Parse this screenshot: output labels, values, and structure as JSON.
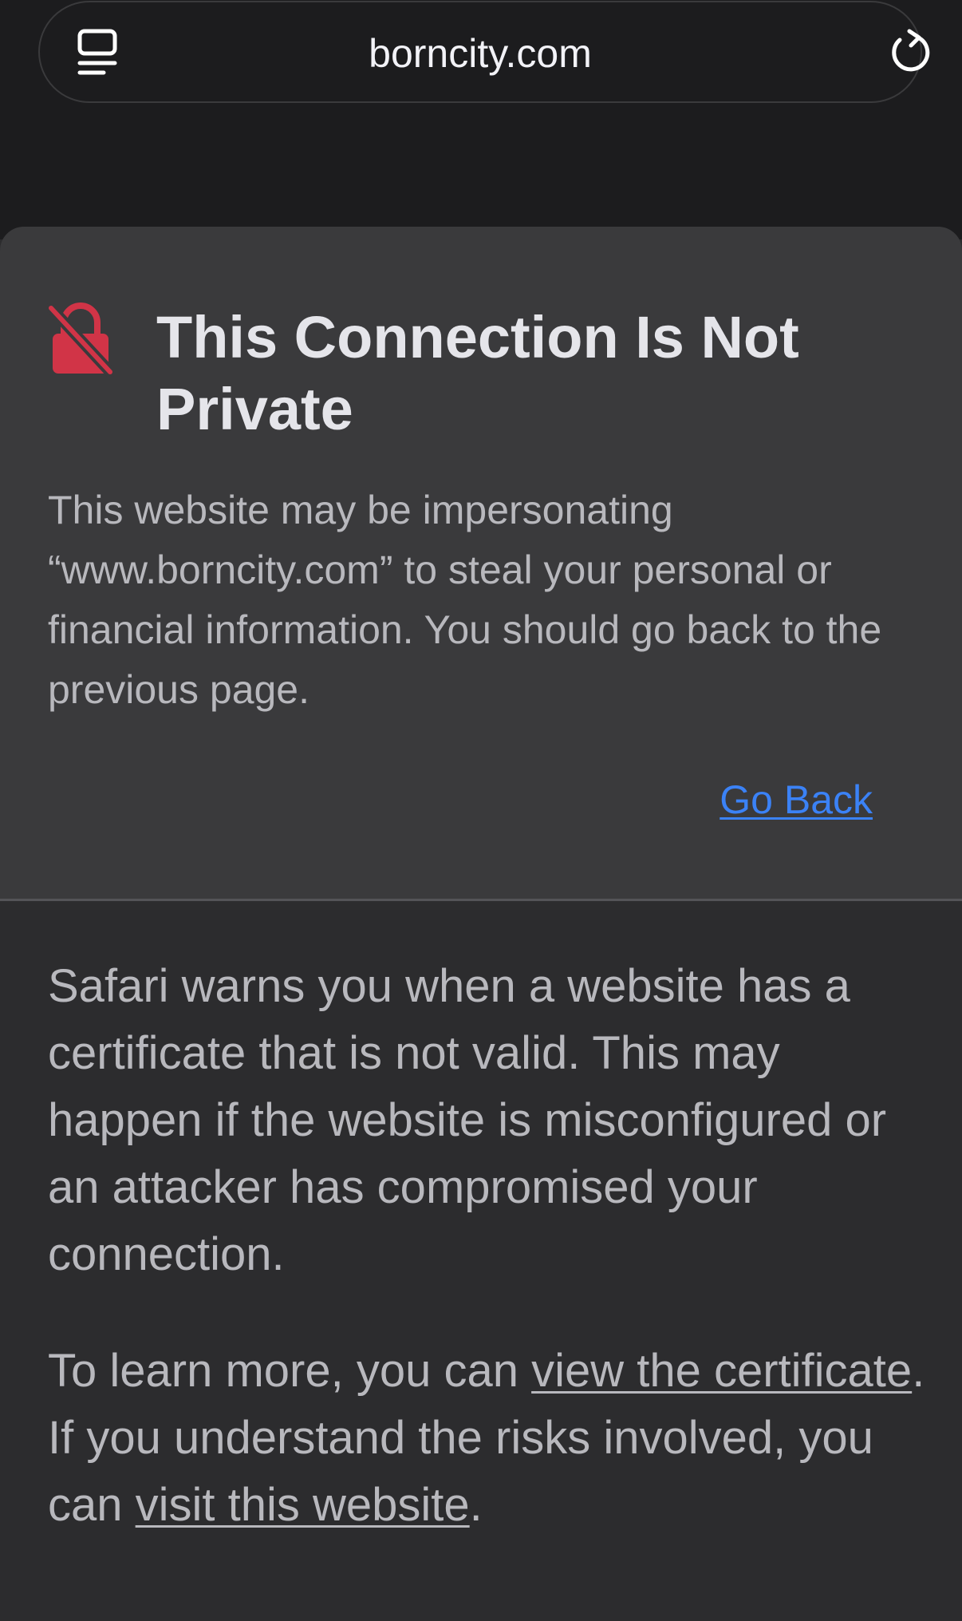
{
  "address_bar": {
    "url": "borncity.com",
    "reader_icon": "reader-mode-icon",
    "reload_icon": "reload-icon"
  },
  "warning": {
    "icon": "lock-slash-icon",
    "title": "This Connection Is Not Private",
    "message": "This website may be impersonating “www.borncity.com” to steal your personal or financial information. You should go back to the previous page.",
    "go_back": "Go Back"
  },
  "details": {
    "explanation": "Safari warns you when a website has a certificate that is not valid. This may happen if the website is misconfigured or an attacker has compromised your connection.",
    "learn_more_prefix": "To learn more, you can ",
    "view_certificate_link": "view the certificate",
    "learn_more_middle": ". If you understand the risks involved, you can ",
    "visit_website_link": "visit this website",
    "learn_more_suffix": "."
  },
  "colors": {
    "background": "#2c2c2e",
    "card": "#3a3a3c",
    "link": "#3b82f6",
    "lock_icon": "#d13447"
  }
}
